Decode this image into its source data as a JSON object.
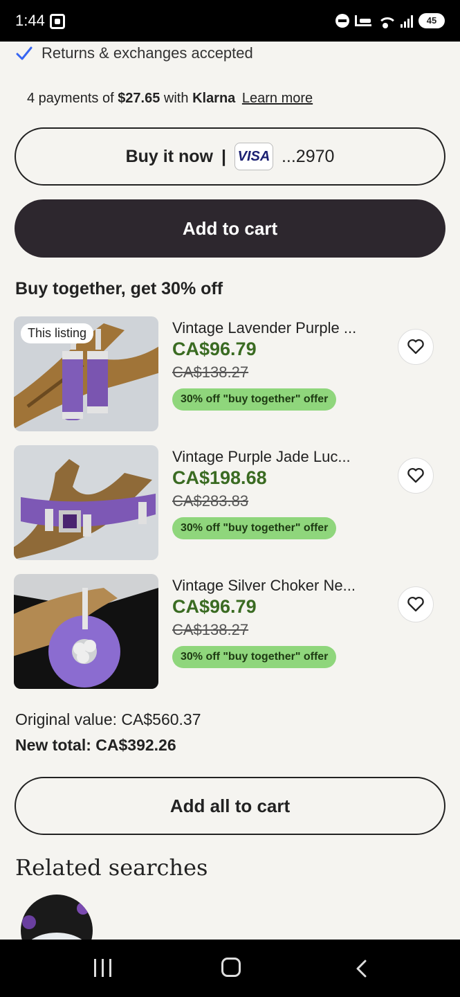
{
  "status_bar": {
    "time": "1:44",
    "battery": "45"
  },
  "shipping": {
    "returns_text": "Returns & exchanges accepted"
  },
  "klarna": {
    "prefix": "4 payments of",
    "amount": "$27.65",
    "with": "with",
    "brand": "Klarna",
    "learn_more": "Learn more"
  },
  "actions": {
    "buy_now": "Buy it now",
    "separator": "|",
    "card_brand": "VISA",
    "card_digits": "...2970",
    "add_to_cart": "Add to cart"
  },
  "bundle": {
    "title": "Buy together, get 30% off",
    "items": [
      {
        "badge": "This listing",
        "title": "Vintage Lavender Purple ...",
        "price": "CA$96.79",
        "old_price": "CA$138.27",
        "offer": "30% off \"buy together\" offer"
      },
      {
        "title": "Vintage Purple Jade Luc...",
        "price": "CA$198.68",
        "old_price": "CA$283.83",
        "offer": "30% off \"buy together\" offer"
      },
      {
        "title": "Vintage Silver Choker Ne...",
        "price": "CA$96.79",
        "old_price": "CA$138.27",
        "offer": "30% off \"buy together\" offer"
      }
    ],
    "original_value": "Original value: CA$560.37",
    "new_total": "New total: CA$392.26",
    "add_all": "Add all to cart"
  },
  "related": {
    "title": "Related searches"
  },
  "colors": {
    "background": "#f5f4f0",
    "price_green": "#3a6b22",
    "offer_green": "#8fd67c",
    "dark_button": "#2d272e",
    "check_blue": "#3665f3"
  }
}
